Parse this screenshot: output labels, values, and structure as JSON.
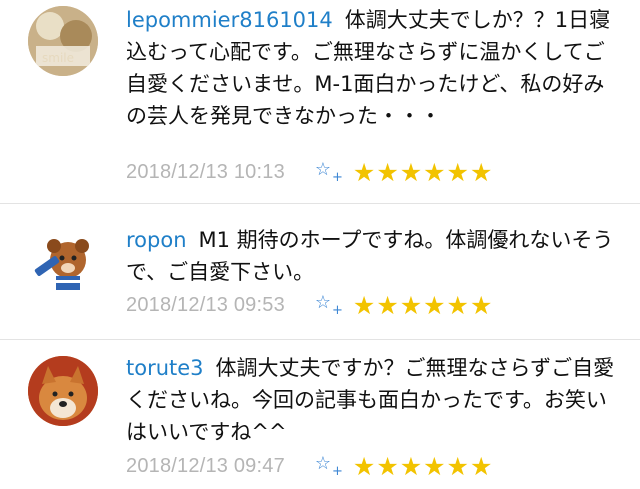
{
  "comments": [
    {
      "username": "lepommier8161014",
      "text": "体調大丈夫でしか？？1日寝込むって心配です。ご無理なさらずに温かくしてご自愛くださいませ。M-1面白かったけど、私の好みの芸人を発見できなかった・・・",
      "timestamp": "2018/12/13 10:13",
      "stars": "★★★★★★",
      "avatar_icon": "dessert-photo-avatar"
    },
    {
      "username": "ropon",
      "text": "M1 期待のホープですね。体調優れないそうで、ご自愛下さい。",
      "timestamp": "2018/12/13 09:53",
      "stars": "★★★★★★",
      "avatar_icon": "cartoon-dog-avatar"
    },
    {
      "username": "torute3",
      "text": "体調大丈夫ですか？ご無理なさらずご自愛くださいね。今回の記事も面白かったです。お笑いはいいですね^^",
      "timestamp": "2018/12/13 09:47",
      "stars": "★★★★★★",
      "avatar_icon": "shiba-dog-avatar"
    }
  ],
  "add_star_icon": "☆",
  "add_star_plus": "+",
  "colors": {
    "username": "#1f7fc8",
    "timestamp": "#b5b5b5",
    "star": "#f2c300",
    "add_star": "#3c86d4"
  }
}
